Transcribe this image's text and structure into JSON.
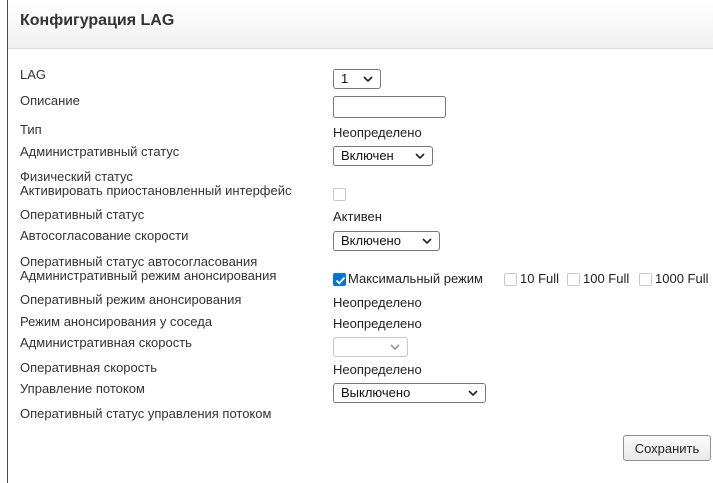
{
  "page": {
    "title": "Конфигурация LAG"
  },
  "labels": {
    "lag": "LAG",
    "description": "Описание",
    "type": "Тип",
    "admin_status": "Административный статус",
    "physical_status": "Физический статус",
    "activate_suspended": "Активировать приостановленный интерфейс",
    "oper_status": "Оперативный статус",
    "autoneg": "Автосогласование скорости",
    "oper_autoneg_status": "Оперативный статус автосогласования",
    "admin_advert_mode": "Административный режим анонсирования",
    "oper_advert_mode": "Оперативный режим анонсирования",
    "neighbor_advert_mode": "Режим анонсирования у соседа",
    "admin_speed": "Административная скорость",
    "oper_speed": "Оперативная скорость",
    "flow_control": "Управление потоком",
    "oper_flow_control_status": "Оперативный статус управления потоком"
  },
  "fields": {
    "lag_value": "1",
    "description_value": "",
    "type_value": "Неопределено",
    "admin_status_value": "Включен",
    "activate_suspended_checked": false,
    "oper_status_value": "Активен",
    "autoneg_value": "Включено",
    "advert_options": [
      {
        "label": "Максимальный режим",
        "checked": true
      },
      {
        "label": "10 Full",
        "checked": false
      },
      {
        "label": "100 Full",
        "checked": false
      },
      {
        "label": "1000 Full",
        "checked": false
      }
    ],
    "oper_advert_value": "Неопределено",
    "neighbor_advert_value": "Неопределено",
    "admin_speed_value": "",
    "oper_speed_value": "Неопределено",
    "flow_control_value": "Выключено"
  },
  "buttons": {
    "save": "Сохранить"
  },
  "icons": {
    "dropdown": "chevron-down-icon",
    "check": "check-icon"
  },
  "colors": {
    "checkbox_accent": "#0075d7"
  }
}
